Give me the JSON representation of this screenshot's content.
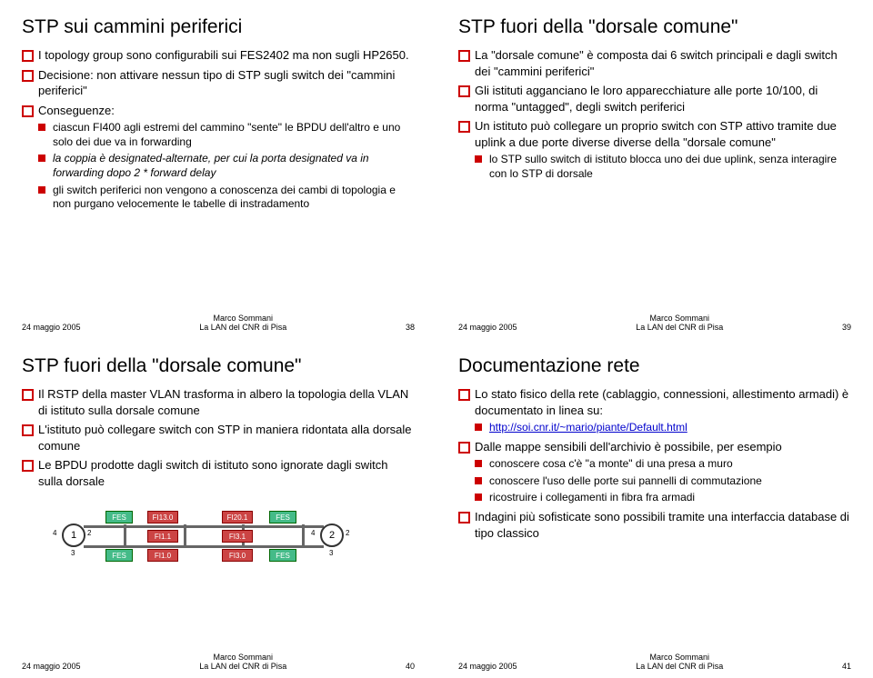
{
  "slides": [
    {
      "title": "STP sui cammini periferici",
      "date": "24 maggio 2005",
      "author": "Marco Sommani",
      "org": "La LAN del CNR di Pisa",
      "page": "38",
      "b1": "I topology group sono configurabili sui FES2402 ma non sugli HP2650.",
      "b2": "Decisione: non attivare nessun tipo di STP sugli switch dei \"cammini periferici\"",
      "b3": "Conseguenze:",
      "b3a": "ciascun FI400 agli estremi del cammino \"sente\" le BPDU dell'altro e uno solo dei due va in forwarding",
      "b3b": "la coppia è designated-alternate, per cui la porta designated va in forwarding dopo 2 * forward delay",
      "b3c": "gli switch periferici non vengono a conoscenza dei cambi di topologia e non purgano velocemente le tabelle di instradamento"
    },
    {
      "title": "STP fuori della \"dorsale comune\"",
      "date": "24 maggio 2005",
      "author": "Marco Sommani",
      "org": "La LAN del CNR di Pisa",
      "page": "39",
      "b1": "La \"dorsale comune\" è composta dai 6 switch principali e dagli switch dei \"cammini periferici\"",
      "b2": "Gli istituti agganciano le loro apparecchiature alle porte 10/100, di norma \"untagged\", degli switch periferici",
      "b3": "Un istituto può collegare un proprio switch con STP attivo tramite due uplink a due porte diverse diverse della \"dorsale comune\"",
      "b3a": "lo STP sullo switch di istituto blocca uno dei due uplink, senza interagire con lo STP di dorsale"
    },
    {
      "title": "STP fuori della \"dorsale comune\"",
      "date": "24 maggio 2005",
      "author": "Marco Sommani",
      "org": "La LAN del CNR di Pisa",
      "page": "40",
      "b1": "Il RSTP della master VLAN trasforma in albero la topologia della VLAN di istituto sulla dorsale comune",
      "b2": "L'istituto può collegare switch con STP in maniera ridontata alla dorsale comune",
      "b3": "Le BPDU prodotte dagli switch di istituto sono ignorate dagli switch sulla dorsale",
      "diagram": {
        "n1": "1",
        "n2": "2",
        "p1l": "4",
        "p1r": "2",
        "p2l": "4",
        "p2r": "2",
        "p1b": "3",
        "p2b": "3",
        "fes": "FES",
        "f1": "FI13.0",
        "f2": "FI20.1",
        "f3": "FI1.1",
        "f4": "FI3.1",
        "f5": "FI1.0",
        "f6": "FI3.0"
      }
    },
    {
      "title": "Documentazione rete",
      "date": "24 maggio 2005",
      "author": "Marco Sommani",
      "org": "La LAN del CNR di Pisa",
      "page": "41",
      "b1": "Lo stato fisico della rete (cablaggio, connessioni, allestimento armadi) è documentato in linea su:",
      "b1a": "http://soi.cnr.it/~mario/piante/Default.html",
      "b2": "Dalle mappe sensibili dell'archivio è possibile, per esempio",
      "b2a": "conoscere cosa c'è \"a monte\" di una presa a muro",
      "b2b": "conoscere l'uso delle porte sui pannelli di commutazione",
      "b2c": "ricostruire i collegamenti in fibra fra armadi",
      "b3": "Indagini più sofisticate sono possibili tramite una interfaccia database di tipo classico"
    }
  ]
}
